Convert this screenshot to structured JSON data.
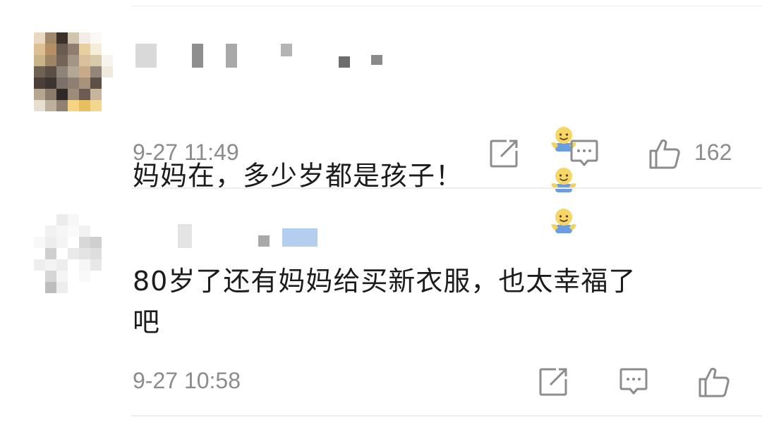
{
  "comments": [
    {
      "text": "妈妈在，多少岁都是孩子！",
      "emoji": [
        "smiley-hug-emoji",
        "smiley-hug-emoji",
        "smiley-hug-emoji"
      ],
      "time": "9-27 11:49",
      "like_count": "162"
    },
    {
      "text": "80岁了还有妈妈给买新衣服，也太幸福了\n吧",
      "time": "9-27 10:58",
      "like_count": ""
    }
  ],
  "icons": {
    "share": "share-edit-icon",
    "comment": "comment-bubble-icon",
    "like": "thumbs-up-icon"
  },
  "colors": {
    "text": "#1c1c1c",
    "meta": "#8c8c8c",
    "divider": "#eeeeee",
    "icon": "#8c8c8c"
  }
}
